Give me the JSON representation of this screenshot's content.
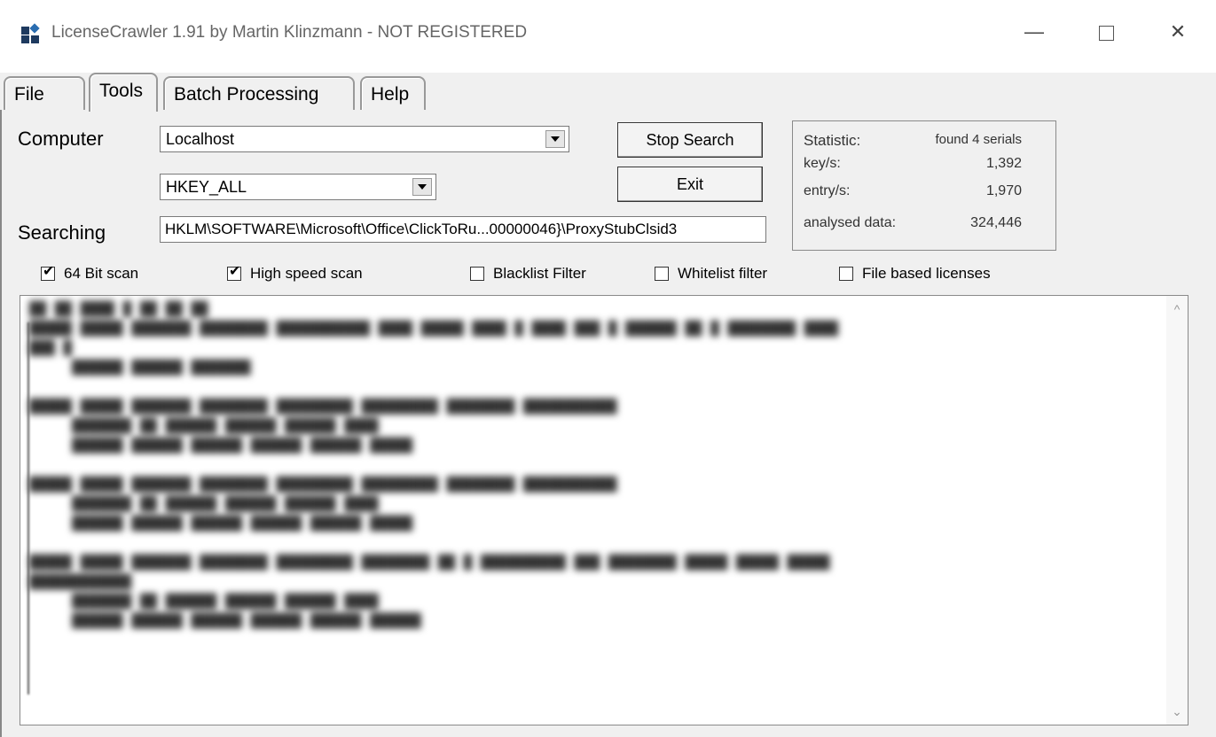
{
  "window": {
    "title": "LicenseCrawler 1.91 by Martin Klinzmann - NOT REGISTERED",
    "icon": "licensecrawler-app-icon",
    "controls": {
      "minimize": "—",
      "close": "✕"
    }
  },
  "tabs": [
    {
      "label": "File"
    },
    {
      "label": "Tools"
    },
    {
      "label": "Batch Processing"
    },
    {
      "label": "Help"
    }
  ],
  "form": {
    "computer_label": "Computer",
    "computer_value": "Localhost",
    "hive_value": "HKEY_ALL",
    "searching_label": "Searching",
    "searching_value": "HKLM\\SOFTWARE\\Microsoft\\Office\\ClickToRu...00000046}\\ProxyStubClsid3"
  },
  "buttons": {
    "stop_search": "Stop Search",
    "exit": "Exit"
  },
  "statistic": {
    "title": "Statistic:",
    "found": "found 4 serials",
    "rows": [
      {
        "key": "key/s:",
        "value": "1,392"
      },
      {
        "key": "entry/s:",
        "value": "1,970"
      },
      {
        "key": "analysed data:",
        "value": "324,446"
      }
    ]
  },
  "options": [
    {
      "label": "64 Bit scan",
      "checked": true
    },
    {
      "label": "High speed scan",
      "checked": true
    },
    {
      "label": "Blacklist Filter",
      "checked": false
    },
    {
      "label": "Whitelist filter",
      "checked": false
    },
    {
      "label": "File based licenses",
      "checked": false
    }
  ],
  "colors": {
    "panel_bg": "#f0f0f0",
    "title_text": "#666666"
  }
}
